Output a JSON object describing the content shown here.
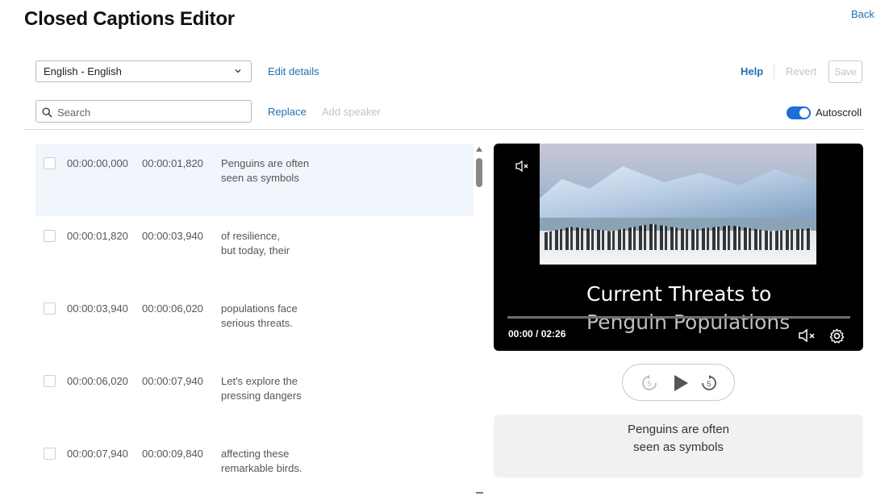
{
  "page": {
    "title": "Closed Captions Editor",
    "back_label": "Back"
  },
  "toolbar": {
    "language_value": "English - English",
    "edit_details": "Edit details",
    "help": "Help",
    "revert": "Revert",
    "save": "Save",
    "search_placeholder": "Search",
    "replace": "Replace",
    "add_speaker": "Add speaker",
    "autoscroll_label": "Autoscroll",
    "autoscroll_on": true
  },
  "captions": [
    {
      "start": "00:00:00,000",
      "end": "00:00:01,820",
      "line1": "Penguins are often",
      "line2": "seen as symbols",
      "active": true
    },
    {
      "start": "00:00:01,820",
      "end": "00:00:03,940",
      "line1": "of resilience,",
      "line2": "but today, their",
      "active": false
    },
    {
      "start": "00:00:03,940",
      "end": "00:00:06,020",
      "line1": "populations face",
      "line2": "serious threats.",
      "active": false
    },
    {
      "start": "00:00:06,020",
      "end": "00:00:07,940",
      "line1": "Let's explore the",
      "line2": "pressing dangers",
      "active": false
    },
    {
      "start": "00:00:07,940",
      "end": "00:00:09,840",
      "line1": "affecting these",
      "line2": "remarkable birds.",
      "active": false
    }
  ],
  "player": {
    "slide_title_line1": "Current Threats to",
    "slide_title_line2": "Penguin Populations",
    "time": "00:00 / 02:26",
    "progress": 0
  },
  "controls": {
    "rewind_seconds": "5",
    "forward_seconds": "5"
  },
  "preview": {
    "line1": "Penguins are often",
    "line2": "seen as symbols"
  },
  "colors": {
    "accent": "#1b6fd6",
    "link": "#1f6fb5",
    "active_row": "#f1f5fc",
    "disabled": "#c3c3c3"
  }
}
